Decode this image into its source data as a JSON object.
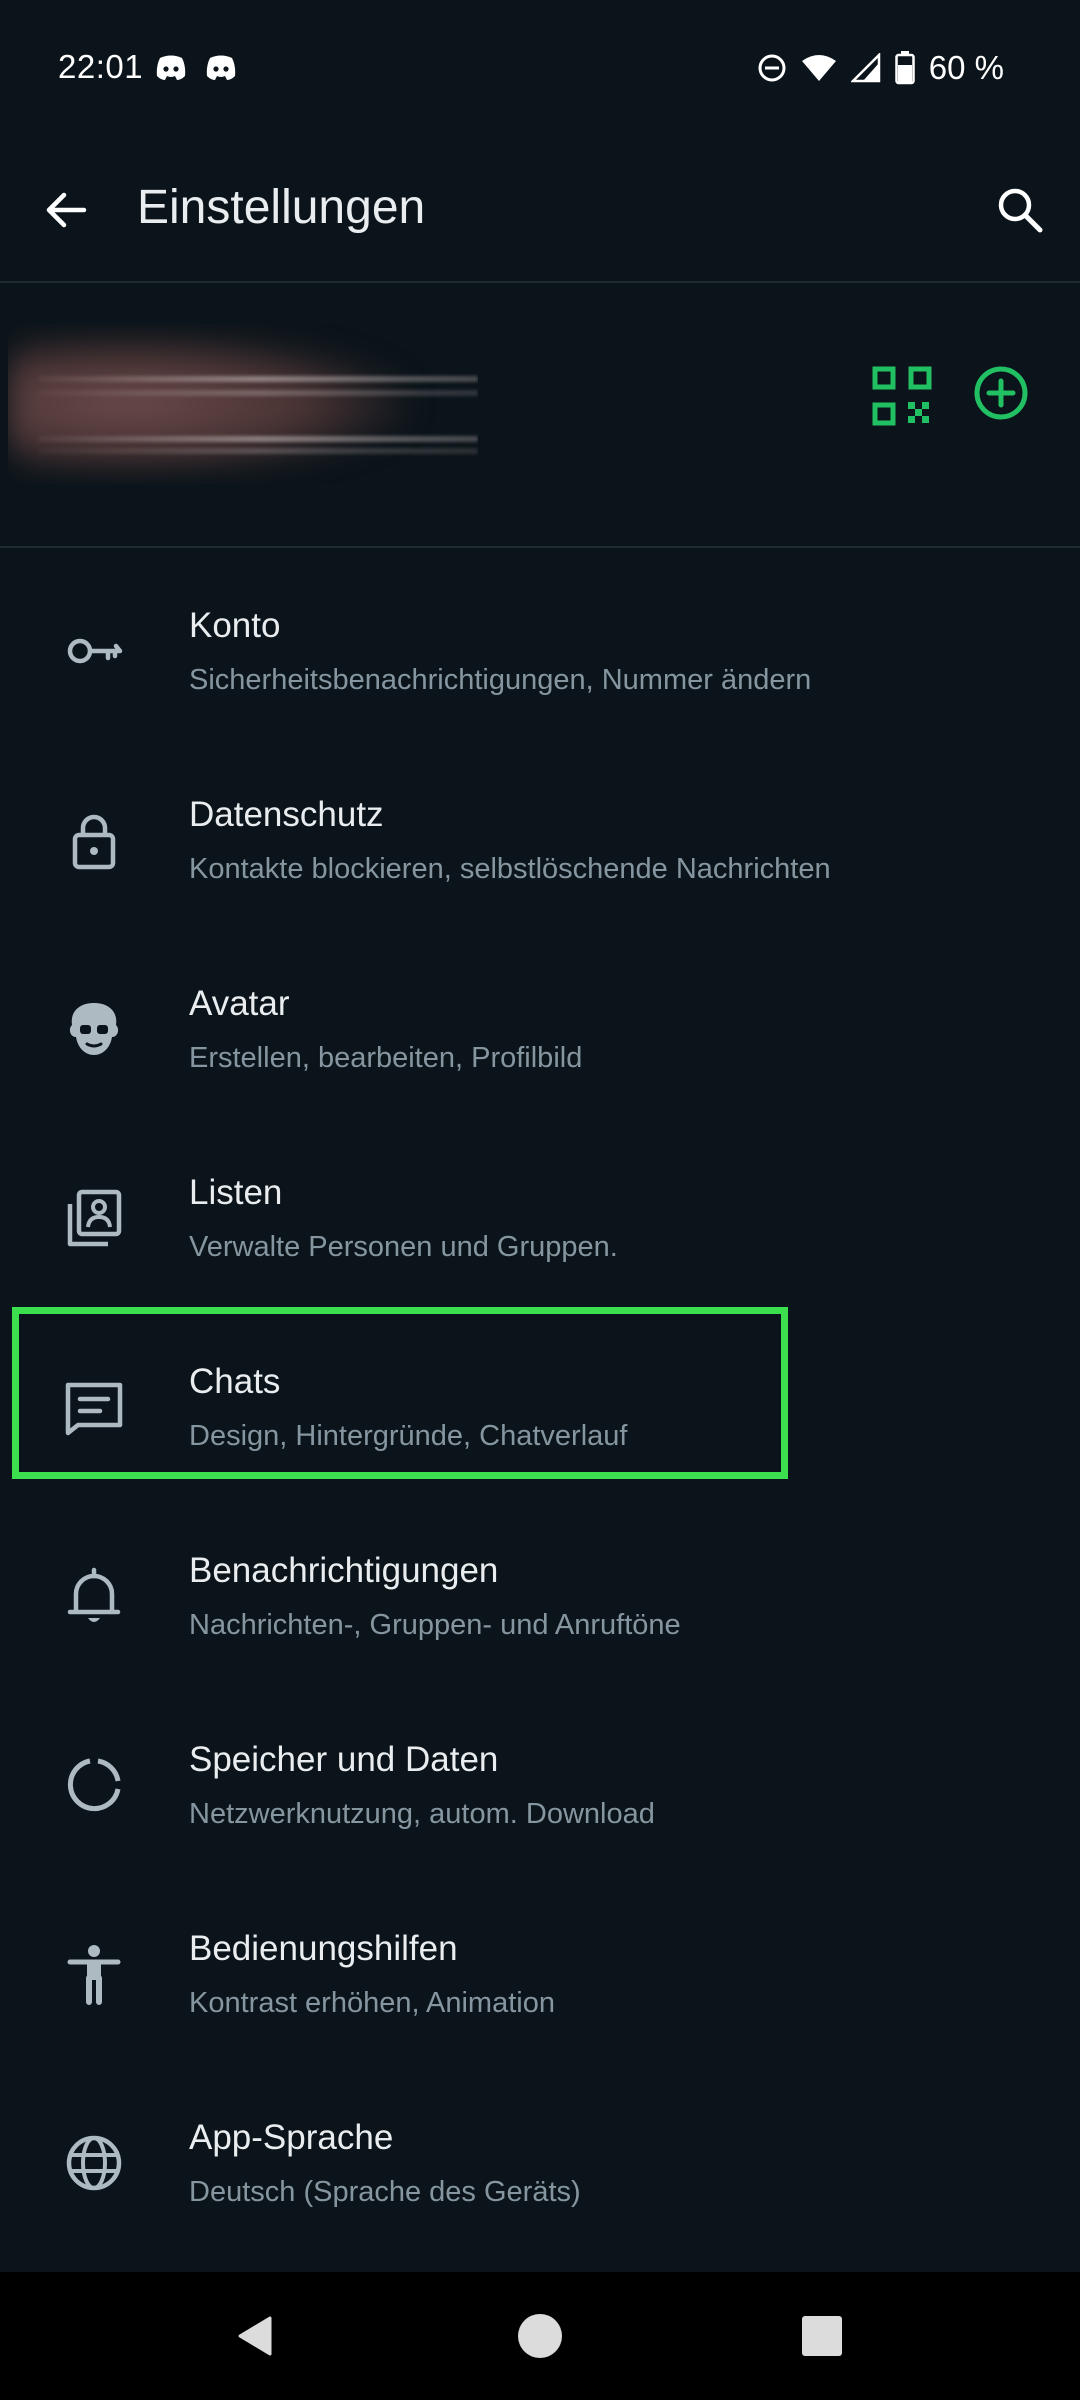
{
  "status_bar": {
    "time": "22:01",
    "battery_text": "60 %",
    "icons": [
      "discord-icon",
      "discord-icon",
      "do-not-disturb-icon",
      "wifi-icon",
      "signal-icon",
      "battery-icon"
    ]
  },
  "toolbar": {
    "title": "Einstellungen",
    "back_icon": "arrow-left-icon",
    "search_icon": "search-icon"
  },
  "profile": {
    "qr_icon": "qr-code-icon",
    "add_icon": "add-circle-icon"
  },
  "settings": [
    {
      "title": "Konto",
      "subtitle": "Sicherheitsbenachrichtigungen, Nummer ändern",
      "icon": "key-icon"
    },
    {
      "title": "Datenschutz",
      "subtitle": "Kontakte blockieren, selbstlöschende Nachrichten",
      "icon": "lock-icon"
    },
    {
      "title": "Avatar",
      "subtitle": "Erstellen, bearbeiten, Profilbild",
      "icon": "avatar-face-icon"
    },
    {
      "title": "Listen",
      "subtitle": "Verwalte Personen und Gruppen.",
      "icon": "contact-list-icon"
    },
    {
      "title": "Chats",
      "subtitle": "Design, Hintergründe, Chatverlauf",
      "icon": "chat-icon"
    },
    {
      "title": "Benachrichtigungen",
      "subtitle": "Nachrichten-, Gruppen- und Anruftöne",
      "icon": "bell-icon"
    },
    {
      "title": "Speicher und Daten",
      "subtitle": "Netzwerknutzung, autom. Download",
      "icon": "data-usage-icon"
    },
    {
      "title": "Bedienungshilfen",
      "subtitle": "Kontrast erhöhen, Animation",
      "icon": "accessibility-icon"
    },
    {
      "title": "App-Sprache",
      "subtitle": "Deutsch (Sprache des Geräts)",
      "icon": "globe-icon"
    }
  ],
  "colors": {
    "background": "#0b141a",
    "accent": "#21c063",
    "highlight": "#3ce04e",
    "title_text": "#e9edef",
    "subtitle_text": "#8696a0",
    "icon": "#aebac1"
  },
  "nav_bar": {
    "icons": [
      "nav-back-icon",
      "nav-home-icon",
      "nav-recents-icon"
    ]
  }
}
